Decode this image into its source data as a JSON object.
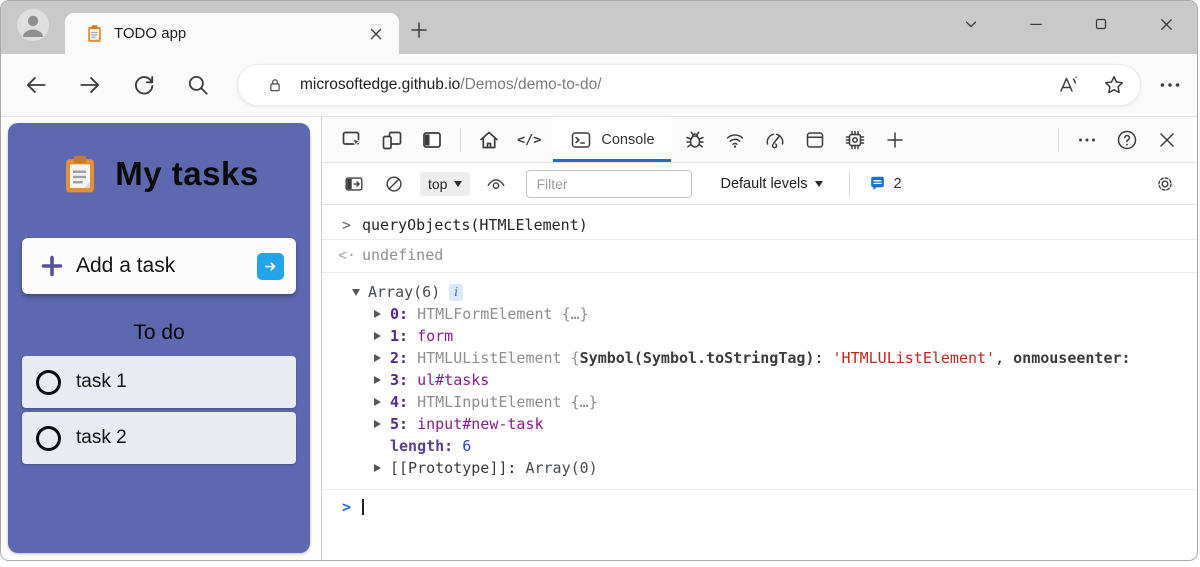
{
  "window": {
    "tab": {
      "title": "TODO app",
      "favicon": "clipboard-icon"
    },
    "controls": [
      "window-menu-chevron",
      "minimize",
      "maximize",
      "close"
    ]
  },
  "navbar": {
    "icons": [
      "back-arrow",
      "forward-arrow",
      "refresh",
      "search",
      "lock",
      "read-aloud",
      "favorite-star",
      "more-ellipsis"
    ],
    "url": {
      "host": "microsoftedge.github.io",
      "path": "/Demos/demo-to-do/"
    }
  },
  "todo_app": {
    "logo": "clipboard-icon",
    "title": "My tasks",
    "add_task": {
      "plus_icon": "plus-icon",
      "label": "Add a task",
      "submit_icon": "arrow-right-icon"
    },
    "section_title": "To do",
    "tasks": [
      {
        "label": "task 1"
      },
      {
        "label": "task 2"
      }
    ],
    "colors": {
      "panel": "#5c68b0",
      "plus_accent": "#544fa0",
      "submit_blue": "#23a3e8",
      "row_bg": "#e9ebf3"
    }
  },
  "devtools": {
    "active_tab": "Console",
    "toolbar_icons": [
      "inspect",
      "device-emulation",
      "activity-bar",
      "welcome-home",
      "source-code",
      "console",
      "debugger-bug",
      "network-wifi",
      "performance-gauge",
      "application-window",
      "memory-chip",
      "add-tools-plus",
      "more-tools-ellipsis",
      "help",
      "close-devtools"
    ],
    "console_toolbar": {
      "icons": [
        "console-sidebar-toggle",
        "clear-console",
        "context-selector",
        "live-expression-eye",
        "filter",
        "levels-dropdown",
        "issues-counter",
        "console-settings-gear"
      ],
      "context": "top",
      "filter_placeholder": "Filter",
      "levels": "Default levels",
      "issues_count": "2"
    },
    "accent_blue": "#1b6fd4",
    "console": {
      "rows": [
        {
          "kind": "input",
          "segments": [
            {
              "t": "queryObjects(HTMLElement)",
              "s": "plain"
            }
          ]
        },
        {
          "kind": "result",
          "segments": [
            {
              "t": "undefined",
              "s": "muted"
            }
          ]
        },
        {
          "kind": "tree",
          "level": 0,
          "arrow": "down",
          "segments": [
            {
              "t": "Array(6)",
              "s": "obj"
            },
            {
              "t": "i",
              "s": "badge"
            }
          ]
        },
        {
          "kind": "tree",
          "level": 1,
          "arrow": "right",
          "segments": [
            {
              "t": "0: ",
              "s": "prop"
            },
            {
              "t": "HTMLFormElement {…}",
              "s": "preview"
            }
          ]
        },
        {
          "kind": "tree",
          "level": 1,
          "arrow": "right",
          "segments": [
            {
              "t": "1: ",
              "s": "prop"
            },
            {
              "t": "form",
              "s": "node"
            }
          ]
        },
        {
          "kind": "tree",
          "level": 1,
          "arrow": "right",
          "segments": [
            {
              "t": "2: ",
              "s": "prop"
            },
            {
              "t": "HTMLUListElement {",
              "s": "preview"
            },
            {
              "t": "Symbol(Symbol.toStringTag)",
              "s": "key"
            },
            {
              "t": ": ",
              "s": "plain"
            },
            {
              "t": "'HTMLUListElement'",
              "s": "string"
            },
            {
              "t": ", ",
              "s": "plain"
            },
            {
              "t": "onmouseenter:",
              "s": "key"
            }
          ]
        },
        {
          "kind": "tree",
          "level": 1,
          "arrow": "right",
          "segments": [
            {
              "t": "3: ",
              "s": "prop"
            },
            {
              "t": "ul#tasks",
              "s": "node"
            }
          ]
        },
        {
          "kind": "tree",
          "level": 1,
          "arrow": "right",
          "segments": [
            {
              "t": "4: ",
              "s": "prop"
            },
            {
              "t": "HTMLInputElement {…}",
              "s": "preview"
            }
          ]
        },
        {
          "kind": "tree",
          "level": 1,
          "arrow": "right",
          "segments": [
            {
              "t": "5: ",
              "s": "prop"
            },
            {
              "t": "input#new-task",
              "s": "node"
            }
          ]
        },
        {
          "kind": "tree",
          "level": 1,
          "arrow": "none",
          "segments": [
            {
              "t": "length: ",
              "s": "prop-dim"
            },
            {
              "t": "6",
              "s": "number"
            }
          ]
        },
        {
          "kind": "tree",
          "level": 1,
          "arrow": "right",
          "segments": [
            {
              "t": "[[Prototype]]",
              "s": "proto"
            },
            {
              "t": ": ",
              "s": "plain"
            },
            {
              "t": "Array(0)",
              "s": "obj"
            }
          ]
        },
        {
          "kind": "prompt",
          "segments": []
        }
      ]
    }
  }
}
